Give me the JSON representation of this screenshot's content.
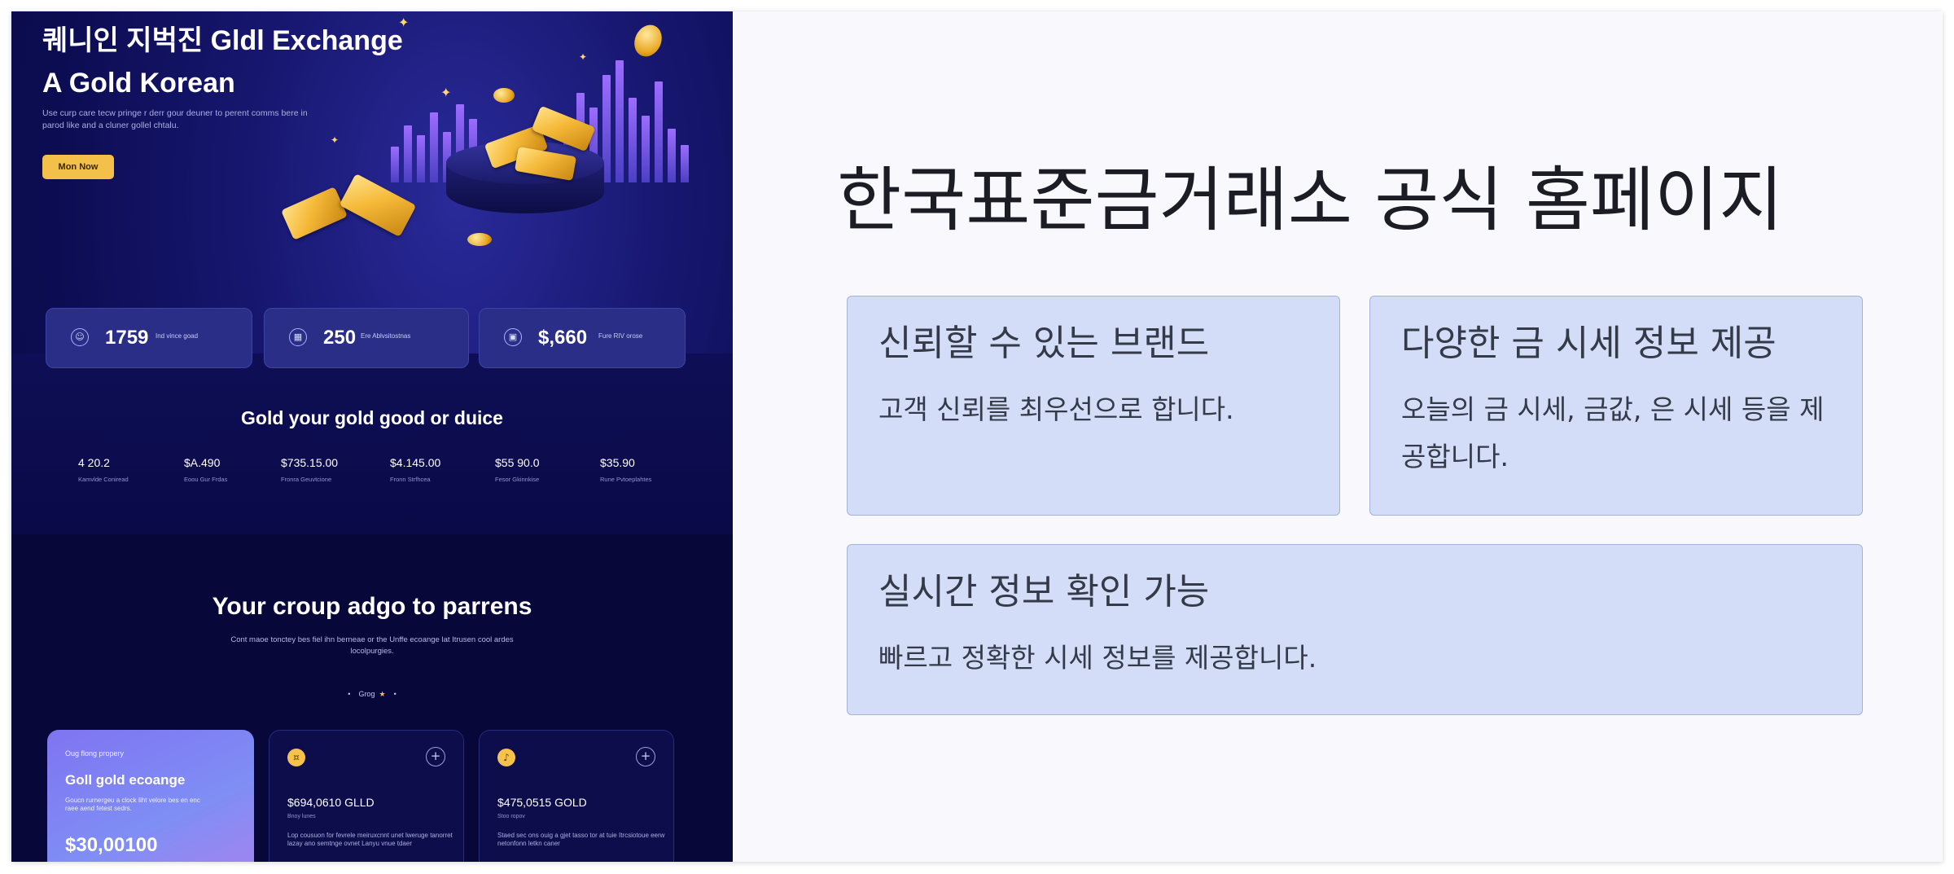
{
  "promo": {
    "title_line1": "퀘니인 지벅진 Gldl Exchange",
    "title_line2": "A Gold Korean",
    "description": "Use curp care tecw pringe r derr gour deuner to perent comms bere in parod like and a cluner gollel chtalu.",
    "cta": "Mon Now",
    "stats": [
      {
        "icon": "user-icon",
        "value": "1759",
        "label": "Ind vince goad"
      },
      {
        "icon": "chart-icon",
        "value": "250",
        "label": "Ere Ablvsitostnas"
      },
      {
        "icon": "wallet-icon",
        "value": "$,660",
        "label": "Fure RIV orose"
      }
    ],
    "prices_title": "Gold your gold good or duice",
    "prices": [
      {
        "value": "4 20.2",
        "label": "Kamvlde Coniread"
      },
      {
        "value": "$A.490",
        "label": "Eoou Gur Frdas"
      },
      {
        "value": "$735.15.00",
        "label": "Fronra Geuvtcione"
      },
      {
        "value": "$4.145.00",
        "label": "Fronn Strfhcea"
      },
      {
        "value": "$55 90.0",
        "label": "Fesor Gkinnkise"
      },
      {
        "value": "$35.90",
        "label": "Rune Pvtoeplahtes"
      }
    ],
    "section2_title": "Your croup adgo to parrens",
    "section2_sub": "Cont maoe tonctey bes fiel ihn berneae or the Unffe ecoange lat Itrusen cool ardes locolpurgies.",
    "pager": "Grog",
    "cards": [
      {
        "tag": "Oug flong propery",
        "name": "Goll gold ecoange",
        "desc": "Goucn rurnergeu a clock Iiht velore bes en enc raee aend fetest sedrs.",
        "amount": "$30,00100"
      },
      {
        "icon": "coin-icon",
        "value": "$694,0610 GLLD",
        "sub": "Bnoy lunes",
        "desc": "Lop cousuon for fevrele meiruxcnnt unet lweruge tanorret lazay ano semtnge ovnet Lanyu vnue tdaer"
      },
      {
        "icon": "bell-icon",
        "value": "$475,0515 GOLD",
        "sub": "Stoo ropov",
        "desc": "Staed sec ons ouig a gjet tasso tor at tuie Itrcsiotoue eerw netonfonn letkn caner"
      }
    ]
  },
  "main": {
    "headline": "한국표준금거래소 공식 홈페이지",
    "features": [
      {
        "title": "신뢰할 수 있는 브랜드",
        "text": "고객 신뢰를 최우선으로 합니다."
      },
      {
        "title": "다양한 금 시세 정보 제공",
        "text": "오늘의 금 시세, 금값, 은 시세 등을 제공합니다."
      },
      {
        "title": "실시간 정보 확인 가능",
        "text": "빠르고 정확한 시세 정보를 제공합니다."
      }
    ]
  },
  "colors": {
    "accent": "#f3c14a",
    "card_bg": "#d3ddf8",
    "card_border": "#a3b4d8",
    "page_bg": "#f8f8fd",
    "promo_bg": "#0c0c52"
  }
}
